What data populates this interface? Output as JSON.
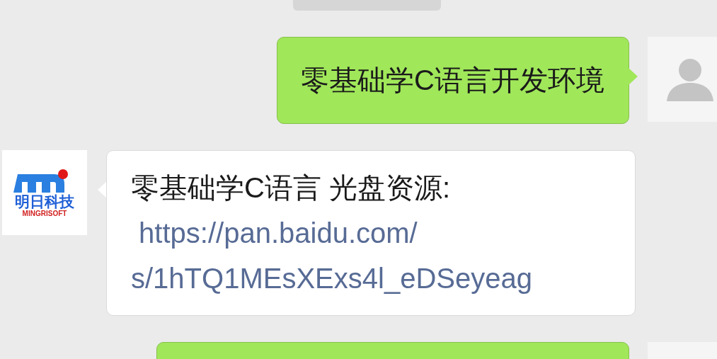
{
  "time_pill": {
    "kind": "time"
  },
  "messages": [
    {
      "kind": "sent",
      "avatar": {
        "kind": "person"
      },
      "text": "零基础学C语言开发环境"
    },
    {
      "kind": "received",
      "avatar": {
        "kind": "logo",
        "name": "明日科技",
        "subtitle": "MINGRISOFT"
      },
      "text": "零基础学C语言 光盘资源:",
      "link_lines": [
        " https://pan.baidu.com/",
        "s/1hTQ1MEsXExs4l_eDSeyeag"
      ]
    },
    {
      "kind": "sent",
      "avatar": {
        "kind": "blank"
      }
    }
  ]
}
